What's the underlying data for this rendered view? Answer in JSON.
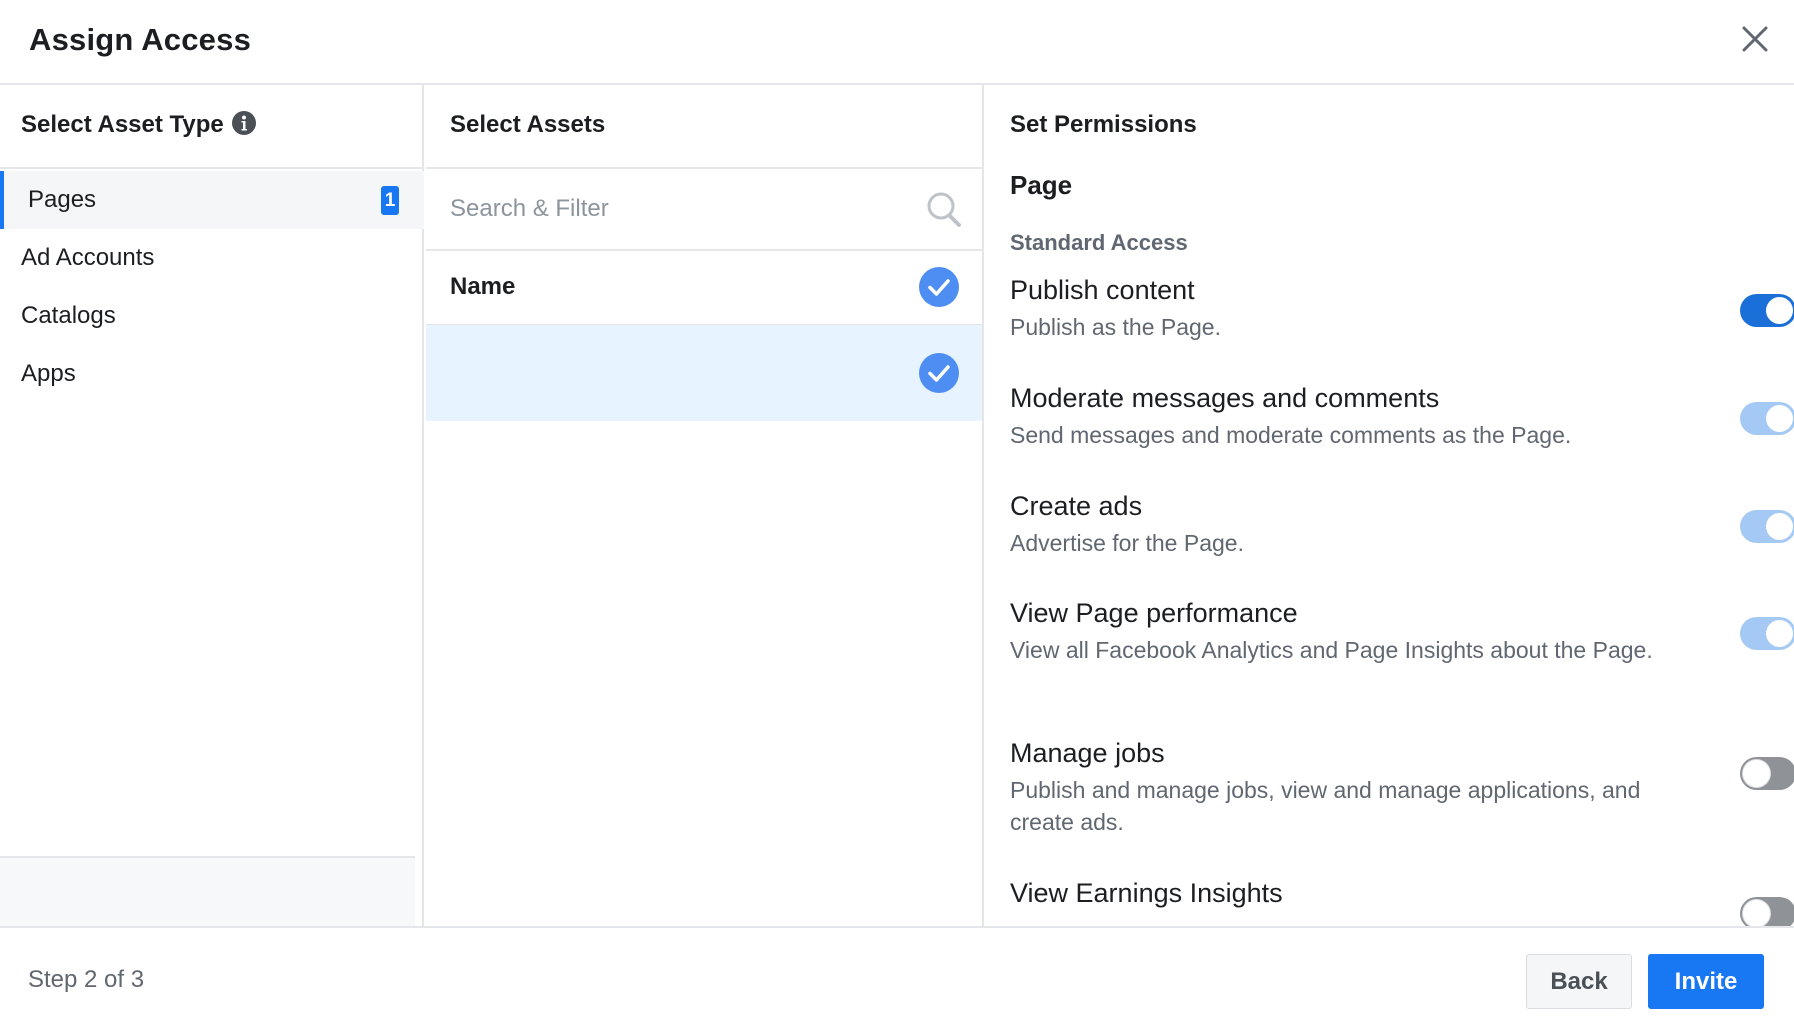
{
  "dialog": {
    "title": "Assign Access",
    "close_icon": "close-icon"
  },
  "left_column": {
    "heading": "Select Asset Type",
    "info_icon": "info-icon",
    "items": [
      {
        "label": "Pages",
        "active": true,
        "badge": "1"
      },
      {
        "label": "Ad Accounts",
        "active": false
      },
      {
        "label": "Catalogs",
        "active": false
      },
      {
        "label": "Apps",
        "active": false
      }
    ]
  },
  "middle_column": {
    "heading": "Select Assets",
    "search": {
      "placeholder": "Search & Filter",
      "value": "",
      "icon": "search-icon"
    },
    "name_header": "Name",
    "name_header_checked": true,
    "rows": [
      {
        "label": "",
        "checked": true,
        "selected": true
      }
    ]
  },
  "right_column": {
    "heading": "Set Permissions",
    "asset_type": "Page",
    "section": "Standard Access",
    "permissions": [
      {
        "title": "Publish content",
        "description": "Publish as the Page.",
        "enabled": true,
        "locked": false
      },
      {
        "title": "Moderate messages and comments",
        "description": "Send messages and moderate comments as the Page.",
        "enabled": true,
        "locked": true
      },
      {
        "title": "Create ads",
        "description": "Advertise for the Page.",
        "enabled": true,
        "locked": true
      },
      {
        "title": "View Page performance",
        "description": "View all Facebook Analytics and Page Insights about the Page.",
        "enabled": true,
        "locked": true
      },
      {
        "title": "Manage jobs",
        "description": "Publish and manage jobs, view and manage applications, and create ads.",
        "enabled": false,
        "locked": false
      },
      {
        "title": "View Earnings Insights",
        "description": "",
        "enabled": false,
        "locked": false
      }
    ]
  },
  "footer": {
    "step_text": "Step 2 of 3",
    "back_label": "Back",
    "invite_label": "Invite"
  },
  "colors": {
    "accent": "#1877f2",
    "toggle_on": "#1b6fd8",
    "toggle_locked": "#a5c9f5",
    "toggle_off": "#8f9296",
    "selected_row": "#e7f3ff"
  }
}
